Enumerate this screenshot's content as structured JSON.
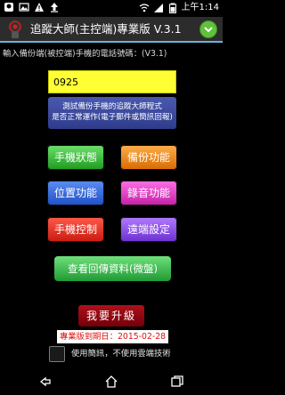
{
  "status_bar": {
    "time": "上午1:14",
    "left_icons": [
      "app-notification-icon",
      "photo-icon",
      "alert-icon",
      "upload-icon"
    ],
    "right_icons": [
      "wifi-icon",
      "signal-icon",
      "battery-icon"
    ]
  },
  "header": {
    "title": "追蹤大師(主控端)專業版 V.3.1",
    "logo": "app-logo-icon",
    "menu": "chevron-down-icon"
  },
  "main": {
    "prompt": "輸入備份端(被控端)手機的電話號碼：(V3.1)",
    "phone_value": "0925",
    "test_button": {
      "line1": "測試備份手機的追蹤大師程式",
      "line2": "是否正常運作(電子郵件或簡訊回報)"
    },
    "buttons": [
      {
        "label": "手機狀態",
        "color": "#3cb43c"
      },
      {
        "label": "備份功能",
        "color": "#ef8a1e"
      },
      {
        "label": "位置功能",
        "color": "#3a6fe0"
      },
      {
        "label": "錄音功能",
        "color": "#e04ac8"
      },
      {
        "label": "手機控制",
        "color": "#e8382a"
      },
      {
        "label": "遠端設定",
        "color": "#8d55ea"
      }
    ],
    "view_data_button": "查看回傳資料(微盤)",
    "upgrade_button": "我要升級",
    "expiry": "專業版到期日：2015-02-28",
    "sms_option_label": "使用簡訊，不使用雲端技術",
    "sms_option_checked": false
  },
  "nav_bar": {
    "icons": [
      "back-icon",
      "home-icon",
      "recent-apps-icon"
    ]
  }
}
